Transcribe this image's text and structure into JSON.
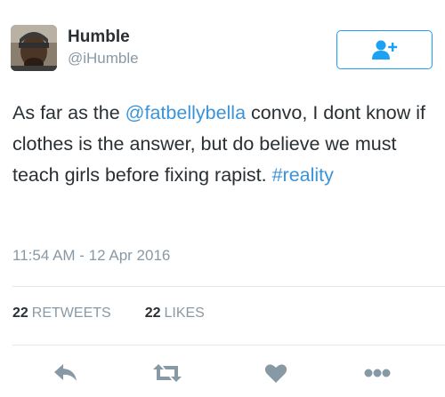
{
  "author": {
    "name": "Humble",
    "handle": "@iHumble"
  },
  "follow_button": {
    "icon": "follow-user-icon",
    "color": "#1da1f2"
  },
  "tweet": {
    "text_before_mention": "As far as the ",
    "mention": "@fatbellybella",
    "text_after_mention": " convo, I dont know if clothes is the answer, but do believe we must teach girls before fixing rapist. ",
    "hashtag": "#reality",
    "link_color": "#3b94d9"
  },
  "timestamp": "11:54 AM - 12 Apr 2016",
  "stats": {
    "retweets_count": "22",
    "retweets_label": "RETWEETS",
    "likes_count": "22",
    "likes_label": "LIKES"
  },
  "actions": [
    {
      "name": "reply",
      "icon": "reply-icon"
    },
    {
      "name": "retweet",
      "icon": "retweet-icon"
    },
    {
      "name": "like",
      "icon": "heart-icon"
    },
    {
      "name": "more",
      "icon": "more-dots-icon"
    }
  ],
  "colors": {
    "text": "#292f33",
    "secondary": "#8899a6",
    "icon": "#8899a6",
    "divider": "#e1e8ed"
  }
}
